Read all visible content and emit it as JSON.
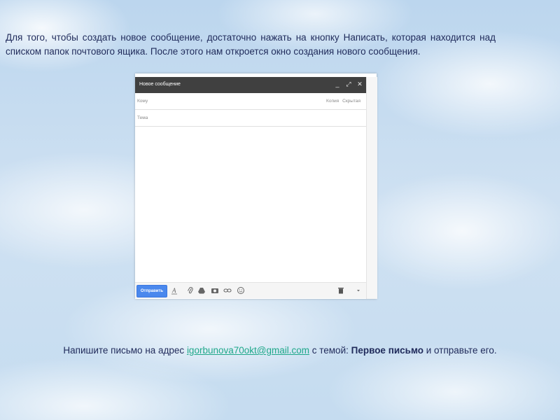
{
  "intro_text": "Для того, чтобы создать новое сообщение, достаточно нажать на кнопку Написать, которая находится над списком папок почтового ящика. После этого нам откроется окно создания нового сообщения.",
  "compose": {
    "title": "Новое сообщение",
    "controls": {
      "minimize": "_",
      "expand": "⤢",
      "close": "✕"
    },
    "to_placeholder": "Кому",
    "cc_label": "Копия",
    "bcc_label": "Скрытая",
    "subject_placeholder": "Тема",
    "send_label": "Отправить",
    "toolbar_icons": [
      "format-text-icon",
      "attach-icon",
      "drive-icon",
      "photo-icon",
      "link-icon",
      "emoji-icon",
      "trash-icon",
      "more-options-icon"
    ]
  },
  "task": {
    "prefix": "Напишите письмо на адрес ",
    "email": "igorbunova70okt@gmail.com",
    "middle": " с темой: ",
    "subject": "Первое письмо",
    "suffix": " и отправьте его."
  },
  "colors": {
    "text": "#1f2a5a",
    "link": "#1fa88a",
    "header": "#404040",
    "send": "#4a88ed"
  }
}
